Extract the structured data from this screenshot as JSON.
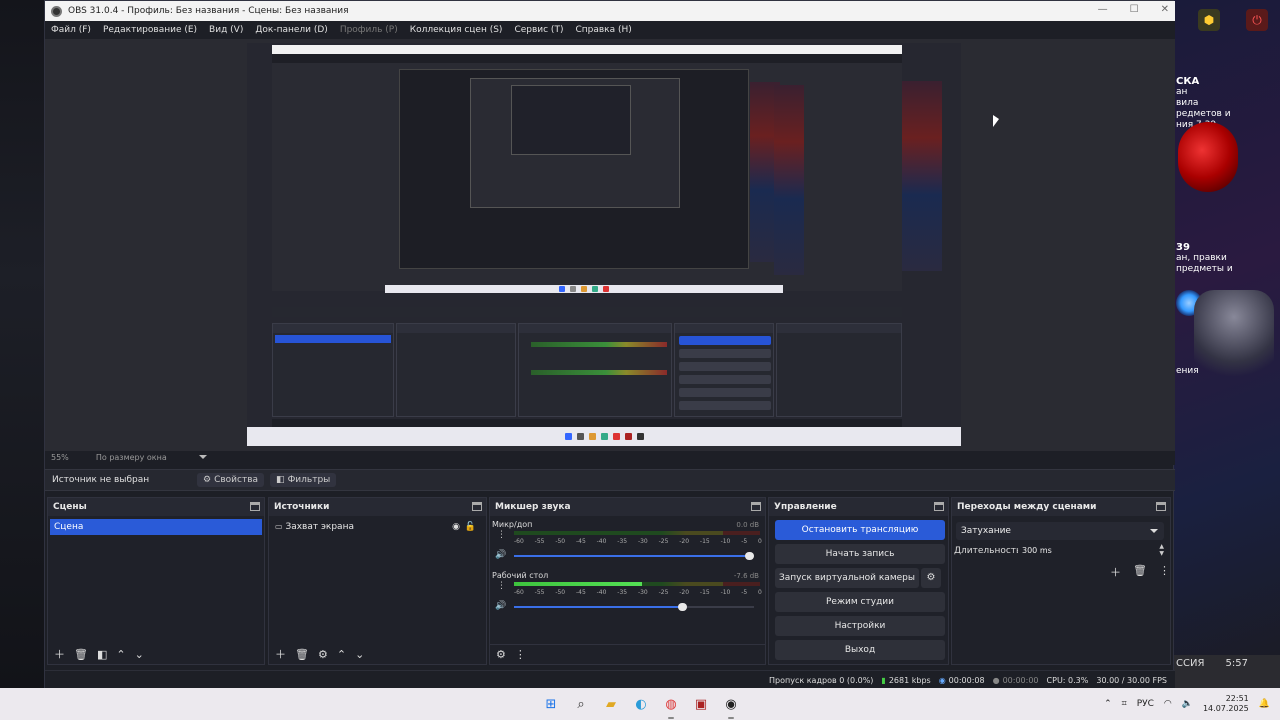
{
  "window": {
    "title": "OBS 31.0.4 - Профиль: Без названия - Сцены: Без названия"
  },
  "menu": [
    {
      "label": "Файл (F)",
      "enabled": true
    },
    {
      "label": "Редактирование (E)",
      "enabled": true
    },
    {
      "label": "Вид (V)",
      "enabled": true
    },
    {
      "label": "Док-панели (D)",
      "enabled": true
    },
    {
      "label": "Профиль (P)",
      "enabled": false
    },
    {
      "label": "Коллекция сцен (S)",
      "enabled": true
    },
    {
      "label": "Сервис (T)",
      "enabled": true
    },
    {
      "label": "Справка (H)",
      "enabled": true
    }
  ],
  "preview": {
    "zoom": "55%",
    "scale_mode": "По размеру окна"
  },
  "source_toolbar": {
    "no_source": "Источник не выбран",
    "properties": "Свойства",
    "filters": "Фильтры"
  },
  "scenes": {
    "title": "Сцены",
    "items": [
      "Сцена"
    ]
  },
  "sources": {
    "title": "Источники",
    "items": [
      "Захват экрана"
    ]
  },
  "mixer": {
    "title": "Микшер звука",
    "channels": [
      {
        "name": "Микр/доп",
        "db": "0.0 dB",
        "level": 0.0,
        "volume": 0.98
      },
      {
        "name": "Рабочий стол",
        "db": "-7.6 dB",
        "level": 0.52,
        "volume": 0.7
      }
    ],
    "ticks": [
      "-60",
      "-55",
      "-50",
      "-45",
      "-40",
      "-35",
      "-30",
      "-25",
      "-20",
      "-15",
      "-10",
      "-5",
      "0"
    ]
  },
  "controls": {
    "title": "Управление",
    "stop_stream": "Остановить трансляцию",
    "start_record": "Начать запись",
    "virtual_cam": "Запуск виртуальной камеры",
    "studio_mode": "Режим студии",
    "settings": "Настройки",
    "exit": "Выход"
  },
  "transitions": {
    "title": "Переходы между сценами",
    "selected": "Затухание",
    "duration_label": "Длительность",
    "duration_value": "300 ms"
  },
  "status": {
    "dropped": "Пропуск кадров 0 (0.0%)",
    "bitrate": "2681 kbps",
    "stream_time": "00:00:08",
    "record_time": "00:00:00",
    "cpu": "CPU: 0.3%",
    "fps": "30.00 / 30.00 FPS"
  },
  "taskbar": {
    "lang": "РУС",
    "time": "22:51",
    "date": "14.07.2025"
  },
  "desktop_right": {
    "text_top": [
      "СКА",
      "ан",
      "вила",
      "редметов и",
      "ния 7.39."
    ],
    "text_mid": [
      "39",
      "ан, правки",
      "предметы и",
      "ения"
    ],
    "text_bot": [
      "ССИЯ",
      "5:57"
    ]
  },
  "colors": {
    "accent": "#2a5bd8",
    "panel": "#1f2129",
    "header": "#272933"
  }
}
